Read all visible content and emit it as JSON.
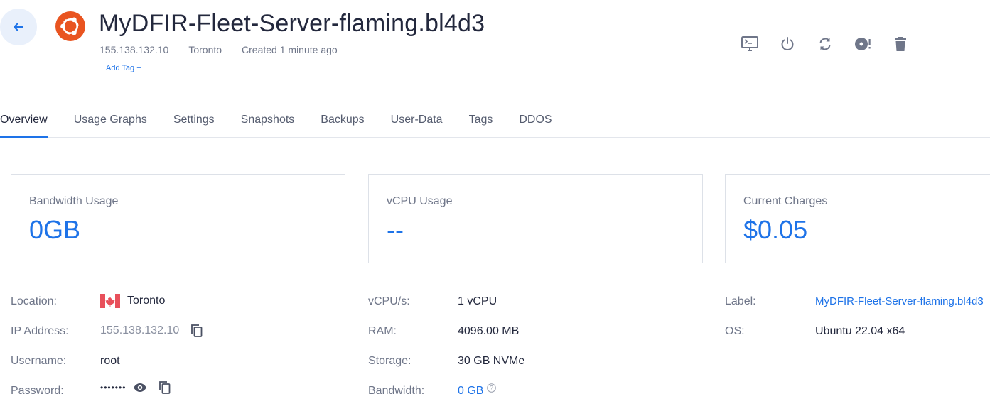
{
  "header": {
    "title": "MyDFIR-Fleet-Server-flaming.bl4d3",
    "ip": "155.138.132.10",
    "location": "Toronto",
    "created": "Created 1 minute ago",
    "add_tag": "Add Tag +",
    "os_icon": "ubuntu-logo-icon",
    "back_icon": "arrow-left-icon"
  },
  "actions": [
    {
      "name": "console-icon"
    },
    {
      "name": "power-icon"
    },
    {
      "name": "restart-icon"
    },
    {
      "name": "reinstall-disc-icon"
    },
    {
      "name": "trash-icon"
    }
  ],
  "tabs": [
    "Overview",
    "Usage Graphs",
    "Settings",
    "Snapshots",
    "Backups",
    "User-Data",
    "Tags",
    "DDOS"
  ],
  "active_tab": "Overview",
  "cards": {
    "bandwidth": {
      "title": "Bandwidth Usage",
      "value": "0GB"
    },
    "vcpu": {
      "title": "vCPU Usage",
      "value": "--"
    },
    "charges": {
      "title": "Current Charges",
      "value": "$0.05"
    }
  },
  "details": {
    "location": {
      "label": "Location:",
      "value": "Toronto",
      "flag": "canada-flag-icon"
    },
    "ip": {
      "label": "IP Address:",
      "value": "155.138.132.10"
    },
    "username": {
      "label": "Username:",
      "value": "root"
    },
    "password": {
      "label": "Password:",
      "value": "•••••••"
    },
    "vcpus": {
      "label": "vCPU/s:",
      "value": "1 vCPU"
    },
    "ram": {
      "label": "RAM:",
      "value": "4096.00 MB"
    },
    "storage": {
      "label": "Storage:",
      "value": "30 GB NVMe"
    },
    "bandwidth": {
      "label": "Bandwidth:",
      "value": "0 GB"
    },
    "label": {
      "label": "Label:",
      "value": "MyDFIR-Fleet-Server-flaming.bl4d3"
    },
    "os": {
      "label": "OS:",
      "value": "Ubuntu 22.04 x64"
    }
  },
  "colors": {
    "accent": "#1e73e8",
    "ubuntu": "#e95420",
    "flag_red": "#e8505b"
  }
}
